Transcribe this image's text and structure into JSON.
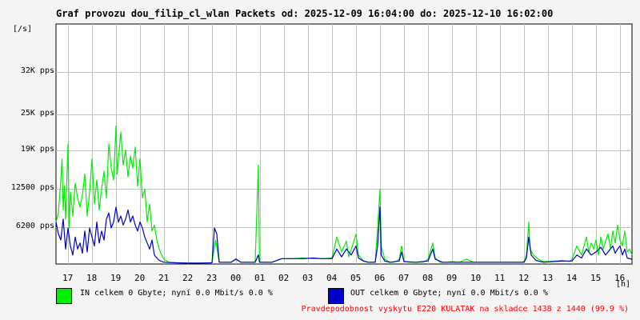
{
  "chart_data": {
    "type": "line",
    "title": "Graf provozu dou_filip_cl_wlan Packets od: 2025-12-09 16:04:00 do: 2025-12-10 16:02:00",
    "unit_label": "[/s]",
    "x_unit_label": "[h]",
    "x_range_hours": [
      16.5,
      40.5
    ],
    "x_tick_values": [
      17,
      18,
      19,
      20,
      21,
      22,
      23,
      24,
      25,
      26,
      27,
      28,
      29,
      30,
      31,
      32,
      33,
      34,
      35,
      36,
      37,
      38,
      39,
      40
    ],
    "x_tick_labels": [
      "17",
      "18",
      "19",
      "20",
      "21",
      "22",
      "23",
      "00",
      "01",
      "02",
      "03",
      "04",
      "05",
      "06",
      "07",
      "08",
      "09",
      "10",
      "11",
      "12",
      "13",
      "14",
      "15",
      "16"
    ],
    "y_range": [
      0,
      40000
    ],
    "y_tick_values": [
      6200,
      12500,
      19000,
      25000,
      32000
    ],
    "y_tick_labels": [
      "6200 pps",
      "12500 pps",
      "19K pps",
      "25K pps",
      "32K pps"
    ],
    "grid": true,
    "colors": {
      "in": "#00ee00",
      "out": "#0000cc",
      "grid": "#c0c0c0",
      "plot_bg": "#ffffff",
      "footer": "#ff0000"
    },
    "series": [
      {
        "name": "IN",
        "color": "#00ee00",
        "points": [
          [
            16.5,
            7000
          ],
          [
            16.6,
            8500
          ],
          [
            16.7,
            14000
          ],
          [
            16.75,
            17500
          ],
          [
            16.8,
            9000
          ],
          [
            16.85,
            13000
          ],
          [
            16.9,
            7500
          ],
          [
            17.0,
            20000
          ],
          [
            17.05,
            6000
          ],
          [
            17.1,
            12000
          ],
          [
            17.2,
            8000
          ],
          [
            17.3,
            13500
          ],
          [
            17.4,
            11000
          ],
          [
            17.5,
            9500
          ],
          [
            17.6,
            11500
          ],
          [
            17.7,
            15000
          ],
          [
            17.8,
            8000
          ],
          [
            17.9,
            12000
          ],
          [
            18.0,
            17500
          ],
          [
            18.1,
            10000
          ],
          [
            18.2,
            14000
          ],
          [
            18.3,
            9000
          ],
          [
            18.4,
            12500
          ],
          [
            18.5,
            15500
          ],
          [
            18.6,
            11000
          ],
          [
            18.7,
            20000
          ],
          [
            18.8,
            16000
          ],
          [
            18.9,
            14000
          ],
          [
            19.0,
            23000
          ],
          [
            19.05,
            15000
          ],
          [
            19.1,
            17500
          ],
          [
            19.2,
            22000
          ],
          [
            19.3,
            16500
          ],
          [
            19.4,
            19000
          ],
          [
            19.5,
            14500
          ],
          [
            19.6,
            18000
          ],
          [
            19.7,
            16000
          ],
          [
            19.8,
            19500
          ],
          [
            19.9,
            13000
          ],
          [
            20.0,
            17500
          ],
          [
            20.1,
            11000
          ],
          [
            20.2,
            12500
          ],
          [
            20.3,
            7000
          ],
          [
            20.4,
            10000
          ],
          [
            20.5,
            5500
          ],
          [
            20.6,
            6500
          ],
          [
            20.7,
            4000
          ],
          [
            20.8,
            2500
          ],
          [
            20.9,
            1500
          ],
          [
            21.0,
            800
          ],
          [
            21.2,
            300
          ],
          [
            21.5,
            200
          ],
          [
            22.0,
            150
          ],
          [
            22.5,
            150
          ],
          [
            23.0,
            200
          ],
          [
            23.15,
            4000
          ],
          [
            23.3,
            300
          ],
          [
            23.8,
            300
          ],
          [
            24.0,
            900
          ],
          [
            24.2,
            300
          ],
          [
            24.8,
            300
          ],
          [
            24.93,
            16500
          ],
          [
            24.98,
            300
          ],
          [
            25.5,
            300
          ],
          [
            25.9,
            900
          ],
          [
            26.3,
            900
          ],
          [
            26.8,
            1000
          ],
          [
            27.2,
            900
          ],
          [
            27.6,
            900
          ],
          [
            28.0,
            1000
          ],
          [
            28.2,
            4500
          ],
          [
            28.4,
            2000
          ],
          [
            28.6,
            3800
          ],
          [
            28.7,
            1200
          ],
          [
            28.85,
            3000
          ],
          [
            29.0,
            5000
          ],
          [
            29.1,
            1500
          ],
          [
            29.3,
            600
          ],
          [
            29.5,
            300
          ],
          [
            29.8,
            300
          ],
          [
            29.9,
            6000
          ],
          [
            30.0,
            12500
          ],
          [
            30.05,
            3000
          ],
          [
            30.2,
            800
          ],
          [
            30.4,
            300
          ],
          [
            30.6,
            300
          ],
          [
            30.8,
            800
          ],
          [
            30.9,
            3000
          ],
          [
            31.0,
            500
          ],
          [
            31.2,
            300
          ],
          [
            31.5,
            300
          ],
          [
            31.8,
            300
          ],
          [
            32.0,
            800
          ],
          [
            32.2,
            3500
          ],
          [
            32.3,
            1000
          ],
          [
            32.5,
            300
          ],
          [
            32.8,
            300
          ],
          [
            33.0,
            400
          ],
          [
            33.3,
            300
          ],
          [
            33.6,
            800
          ],
          [
            33.9,
            300
          ],
          [
            34.2,
            300
          ],
          [
            34.5,
            300
          ],
          [
            34.8,
            300
          ],
          [
            35.0,
            300
          ],
          [
            35.3,
            300
          ],
          [
            35.6,
            300
          ],
          [
            35.9,
            300
          ],
          [
            36.0,
            400
          ],
          [
            36.1,
            1500
          ],
          [
            36.2,
            7000
          ],
          [
            36.25,
            2500
          ],
          [
            36.4,
            1500
          ],
          [
            36.6,
            800
          ],
          [
            36.8,
            400
          ],
          [
            37.0,
            400
          ],
          [
            37.3,
            500
          ],
          [
            37.6,
            600
          ],
          [
            37.9,
            400
          ],
          [
            38.0,
            800
          ],
          [
            38.2,
            3000
          ],
          [
            38.4,
            1500
          ],
          [
            38.6,
            4500
          ],
          [
            38.7,
            2000
          ],
          [
            38.8,
            3500
          ],
          [
            38.9,
            2500
          ],
          [
            39.0,
            4000
          ],
          [
            39.1,
            1500
          ],
          [
            39.2,
            4500
          ],
          [
            39.3,
            2500
          ],
          [
            39.4,
            3800
          ],
          [
            39.5,
            5000
          ],
          [
            39.6,
            2500
          ],
          [
            39.7,
            5500
          ],
          [
            39.8,
            3500
          ],
          [
            39.9,
            6500
          ],
          [
            40.0,
            4000
          ],
          [
            40.1,
            3000
          ],
          [
            40.2,
            5500
          ],
          [
            40.3,
            2000
          ],
          [
            40.4,
            2500
          ],
          [
            40.5,
            1500
          ]
        ]
      },
      {
        "name": "OUT",
        "color": "#0000cc",
        "points": [
          [
            16.5,
            7000
          ],
          [
            16.6,
            5000
          ],
          [
            16.7,
            4000
          ],
          [
            16.8,
            7500
          ],
          [
            16.9,
            2500
          ],
          [
            17.0,
            6000
          ],
          [
            17.1,
            3000
          ],
          [
            17.2,
            1500
          ],
          [
            17.3,
            4500
          ],
          [
            17.4,
            2500
          ],
          [
            17.5,
            3500
          ],
          [
            17.6,
            1800
          ],
          [
            17.7,
            5500
          ],
          [
            17.8,
            2000
          ],
          [
            17.9,
            6000
          ],
          [
            18.0,
            4500
          ],
          [
            18.1,
            3000
          ],
          [
            18.2,
            7000
          ],
          [
            18.3,
            3500
          ],
          [
            18.4,
            5500
          ],
          [
            18.5,
            4000
          ],
          [
            18.6,
            7500
          ],
          [
            18.7,
            8500
          ],
          [
            18.8,
            6000
          ],
          [
            18.9,
            7000
          ],
          [
            19.0,
            9500
          ],
          [
            19.1,
            7000
          ],
          [
            19.2,
            8000
          ],
          [
            19.3,
            6500
          ],
          [
            19.4,
            7500
          ],
          [
            19.5,
            9000
          ],
          [
            19.6,
            7000
          ],
          [
            19.7,
            8000
          ],
          [
            19.8,
            6500
          ],
          [
            19.9,
            5500
          ],
          [
            20.0,
            7000
          ],
          [
            20.1,
            6000
          ],
          [
            20.2,
            4500
          ],
          [
            20.3,
            3500
          ],
          [
            20.4,
            2500
          ],
          [
            20.5,
            4000
          ],
          [
            20.6,
            1500
          ],
          [
            20.7,
            1000
          ],
          [
            20.8,
            600
          ],
          [
            21.0,
            300
          ],
          [
            21.5,
            200
          ],
          [
            22.0,
            150
          ],
          [
            22.5,
            150
          ],
          [
            23.0,
            200
          ],
          [
            23.1,
            6000
          ],
          [
            23.2,
            5000
          ],
          [
            23.3,
            300
          ],
          [
            23.8,
            300
          ],
          [
            24.0,
            800
          ],
          [
            24.2,
            300
          ],
          [
            24.8,
            300
          ],
          [
            24.93,
            1500
          ],
          [
            24.98,
            300
          ],
          [
            25.5,
            300
          ],
          [
            25.9,
            900
          ],
          [
            26.3,
            900
          ],
          [
            26.8,
            900
          ],
          [
            27.2,
            1000
          ],
          [
            27.6,
            900
          ],
          [
            28.0,
            900
          ],
          [
            28.2,
            2500
          ],
          [
            28.4,
            1200
          ],
          [
            28.6,
            2500
          ],
          [
            28.8,
            1500
          ],
          [
            29.0,
            3000
          ],
          [
            29.1,
            1000
          ],
          [
            29.3,
            500
          ],
          [
            29.5,
            300
          ],
          [
            29.8,
            300
          ],
          [
            29.9,
            3000
          ],
          [
            30.0,
            9500
          ],
          [
            30.05,
            1500
          ],
          [
            30.2,
            500
          ],
          [
            30.4,
            300
          ],
          [
            30.8,
            500
          ],
          [
            30.9,
            2000
          ],
          [
            31.0,
            400
          ],
          [
            31.5,
            300
          ],
          [
            32.0,
            500
          ],
          [
            32.2,
            2500
          ],
          [
            32.3,
            800
          ],
          [
            32.6,
            300
          ],
          [
            33.0,
            300
          ],
          [
            33.5,
            300
          ],
          [
            34.0,
            300
          ],
          [
            34.5,
            300
          ],
          [
            35.0,
            300
          ],
          [
            35.5,
            300
          ],
          [
            36.0,
            300
          ],
          [
            36.1,
            1000
          ],
          [
            36.2,
            4500
          ],
          [
            36.3,
            1500
          ],
          [
            36.5,
            600
          ],
          [
            36.8,
            300
          ],
          [
            37.2,
            400
          ],
          [
            37.6,
            500
          ],
          [
            38.0,
            500
          ],
          [
            38.2,
            1500
          ],
          [
            38.4,
            1000
          ],
          [
            38.6,
            2500
          ],
          [
            38.8,
            1500
          ],
          [
            39.0,
            2000
          ],
          [
            39.2,
            2800
          ],
          [
            39.4,
            1500
          ],
          [
            39.6,
            2500
          ],
          [
            39.7,
            3000
          ],
          [
            39.8,
            1800
          ],
          [
            39.9,
            2500
          ],
          [
            40.0,
            3000
          ],
          [
            40.1,
            1500
          ],
          [
            40.2,
            2500
          ],
          [
            40.3,
            1000
          ],
          [
            40.5,
            800
          ]
        ]
      }
    ]
  },
  "legend": {
    "in_text": "IN celkem 0 Gbyte; nyní   0.0 Mbit/s 0.0 %",
    "out_text": "OUT celkem 0 Gbyte; nyní   0.0 Mbit/s 0.0 %"
  },
  "footer": {
    "note": "Pravdepodobnost vyskytu E220 KULATAK na skladce 1438 z 1440 (99.9 %)"
  }
}
